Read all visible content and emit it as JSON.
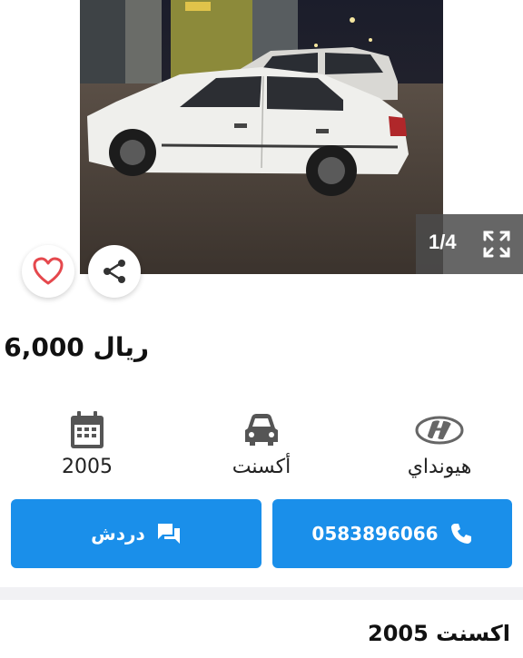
{
  "gallery": {
    "counter": "1/4",
    "prev_icon": "chevron-left-icon",
    "next_icon": "chevron-right-icon",
    "fullscreen_icon": "fullscreen-icon"
  },
  "actions": {
    "favorite_icon": "heart-icon",
    "share_icon": "share-icon"
  },
  "listing": {
    "price": "6,000 ريال",
    "specs": [
      {
        "icon": "calendar-icon",
        "value": "2005"
      },
      {
        "icon": "car-icon",
        "value": "أكسنت"
      },
      {
        "icon": "hyundai-logo-icon",
        "value": "هيونداي"
      }
    ],
    "title": "اكسنت 2005"
  },
  "buttons": {
    "chat_label": "دردش",
    "call_label": "0583896066"
  },
  "colors": {
    "accent": "#1a8fea",
    "heart": "#e5484d"
  }
}
